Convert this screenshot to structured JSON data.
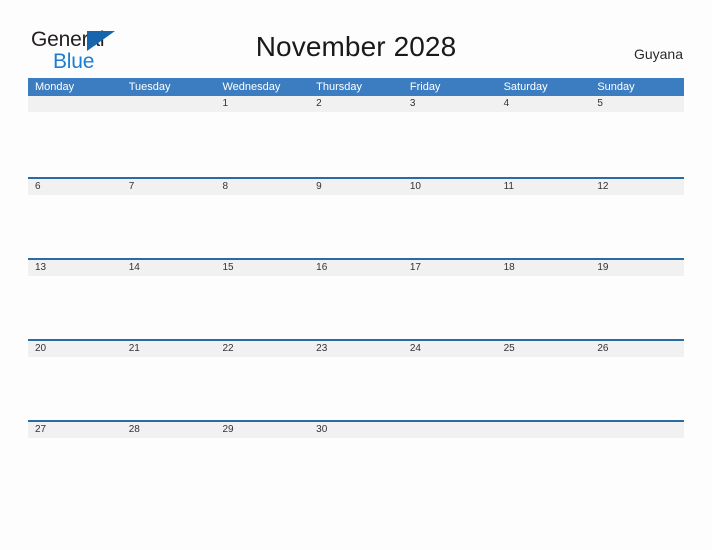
{
  "brand": {
    "line1": "General",
    "line2": "Blue",
    "flag_icon": "triangle-flag-icon",
    "colors": {
      "general": "#231f20",
      "blue": "#1a7fd4",
      "flag": "#1766ad"
    }
  },
  "header": {
    "title": "November 2028",
    "region": "Guyana"
  },
  "theme": {
    "header_blue": "#3c7dc1",
    "rule_blue": "#2a6ba6",
    "band_gray": "#f1f1f1",
    "page_background": "#fdfdfd",
    "text": "#333333"
  },
  "calendar": {
    "month": "November",
    "year": "2028",
    "weekday_headers": [
      "Monday",
      "Tuesday",
      "Wednesday",
      "Thursday",
      "Friday",
      "Saturday",
      "Sunday"
    ],
    "weeks": [
      [
        "",
        "",
        "1",
        "2",
        "3",
        "4",
        "5"
      ],
      [
        "6",
        "7",
        "8",
        "9",
        "10",
        "11",
        "12"
      ],
      [
        "13",
        "14",
        "15",
        "16",
        "17",
        "18",
        "19"
      ],
      [
        "20",
        "21",
        "22",
        "23",
        "24",
        "25",
        "26"
      ],
      [
        "27",
        "28",
        "29",
        "30",
        "",
        "",
        ""
      ]
    ]
  }
}
